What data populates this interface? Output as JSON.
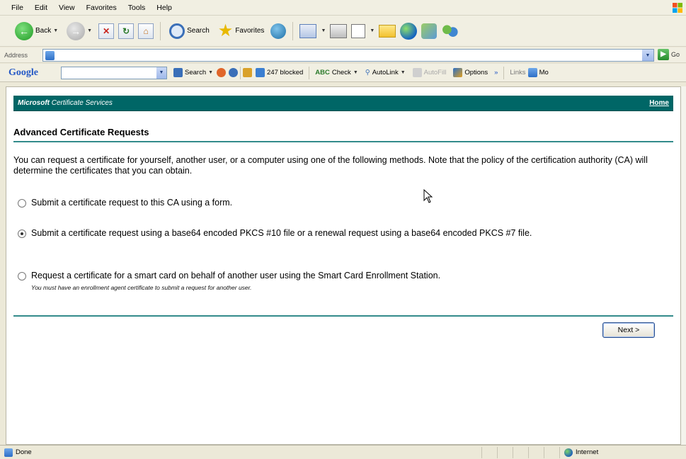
{
  "menu": [
    "File",
    "Edit",
    "View",
    "Favorites",
    "Tools",
    "Help"
  ],
  "toolbar": {
    "back_label": "Back",
    "search_label": "Search",
    "favorites_label": "Favorites"
  },
  "address": {
    "label": "Address",
    "go_label": "Go"
  },
  "google_toolbar": {
    "logo": "Google",
    "search_label": "Search",
    "blocked_label": "247 blocked",
    "check_label": "Check",
    "autolink_label": "AutoLink",
    "autofill_label": "AutoFill",
    "options_label": "Options",
    "more_label": "»",
    "links_label": "Links",
    "mo_label": "Mo"
  },
  "page": {
    "header_brand": "Microsoft",
    "header_service": " Certificate Services",
    "home_link": "Home",
    "title": "Advanced Certificate Requests",
    "intro": "You can request a certificate for yourself, another user, or a computer using one of the following methods. Note that the policy of the certification authority (CA) will determine the certificates that you can obtain.",
    "options": [
      {
        "text": "Submit a certificate request to this CA using a form.",
        "selected": false
      },
      {
        "text": "Submit a certificate request using a base64 encoded PKCS #10 file or a renewal request using a base64 encoded PKCS #7 file.",
        "selected": true
      },
      {
        "text": "Request a certificate for a smart card on behalf of another user using the Smart Card Enrollment Station.",
        "note": "You must have an enrollment agent certificate to submit a request for another user.",
        "selected": false
      }
    ],
    "next_button": "Next >"
  },
  "status": {
    "left": "Done",
    "zone": "Internet"
  },
  "colors": {
    "header_bg": "#006666",
    "rule": "#338b8b"
  }
}
